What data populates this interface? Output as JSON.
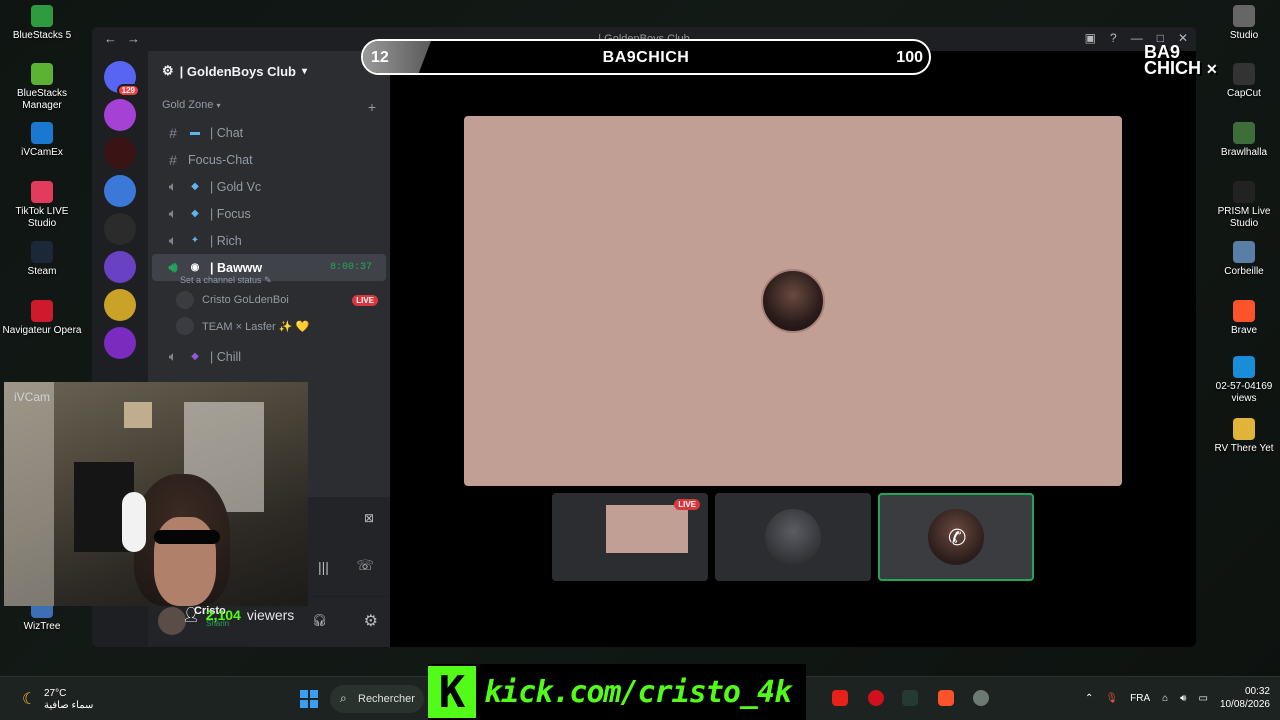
{
  "desktop_left": [
    {
      "label": "BlueStacks 5",
      "color": "#2e9c3e"
    },
    {
      "label": "BlueStacks Manager",
      "color": "#5bb233"
    },
    {
      "label": "iVCamEx",
      "color": "#1b78d0"
    },
    {
      "label": "TikTok LIVE Studio",
      "color": "#e33b5b"
    },
    {
      "label": "Steam",
      "color": "#1b2838"
    },
    {
      "label": "Navigateur Opera",
      "color": "#cf1a2b"
    },
    {
      "label": "WizTree",
      "color": "#3c6fb6"
    }
  ],
  "desktop_right": [
    {
      "label": "Studio",
      "color": "#666666"
    },
    {
      "label": "CapCut",
      "color": "#333333"
    },
    {
      "label": "Brawlhalla",
      "color": "#3f6d3a"
    },
    {
      "label": "PRISM Live Studio",
      "color": "#222222"
    },
    {
      "label": "Corbeille",
      "color": "#5a7fa6"
    },
    {
      "label": "Brave",
      "color": "#fb542b"
    },
    {
      "label": "02-57-04169 views",
      "color": "#1a8dd8"
    },
    {
      "label": "RV There Yet",
      "color": "#e0b43a"
    }
  ],
  "window": {
    "title": "| GoldenBoys Club"
  },
  "servers": [
    {
      "name": "discord-home",
      "color": "#5865f2",
      "badge": "129"
    },
    {
      "name": "server-m",
      "color": "#a641d6",
      "badge": ""
    },
    {
      "name": "server-team",
      "color": "#3a1414",
      "badge": ""
    },
    {
      "name": "server-avatar",
      "color": "#3c78d8",
      "badge": ""
    },
    {
      "name": "server-emblem",
      "color": "#2b2b2b",
      "badge": ""
    },
    {
      "name": "server-fga",
      "color": "#6842c2",
      "badge": ""
    },
    {
      "name": "server-goldenboys",
      "color": "#c9a227",
      "badge": ""
    },
    {
      "name": "server-purple",
      "color": "#7b2cbf",
      "badge": ""
    }
  ],
  "guild": {
    "name": "| GoldenBoys Club"
  },
  "category": "Gold Zone",
  "channels": [
    {
      "type": "text",
      "emoji": "▬",
      "name": "| Chat"
    },
    {
      "type": "text",
      "emoji": "",
      "name": "Focus-Chat"
    },
    {
      "type": "voice",
      "emoji": "◆",
      "name": "| Gold Vc"
    },
    {
      "type": "voice",
      "emoji": "◆",
      "name": "| Focus"
    },
    {
      "type": "voice",
      "emoji": "✦",
      "name": "| Rich"
    }
  ],
  "active_channel": {
    "name": "| Bawww",
    "timer": "8:00:37",
    "status": "Set a channel status"
  },
  "voice_users": [
    {
      "name": "Cristo GoLdenBoi",
      "live": "LIVE"
    },
    {
      "name": "TEAM × Lasfer ✨ 💛",
      "live": ""
    }
  ],
  "extra_channel": {
    "name": "| Chill"
  },
  "scorebar": {
    "left": "12",
    "name": "BA9CHICH",
    "right": "100"
  },
  "logo_text": "BA9 CHICH",
  "cam_label": "iVCam",
  "viewers": {
    "count": "2,104",
    "label": "viewers"
  },
  "thumb_live": "LIVE",
  "user_panel": {
    "name": "Cristo",
    "status": "Sharin"
  },
  "taskbar": {
    "weather_temp": "27°C",
    "weather_desc": "سماء صافية",
    "search": "Rechercher",
    "lang": "FRA",
    "time": "00:32",
    "date": "10/08/2026"
  },
  "kick": {
    "letter": "K",
    "url": "kick.com/cristo_4k"
  }
}
